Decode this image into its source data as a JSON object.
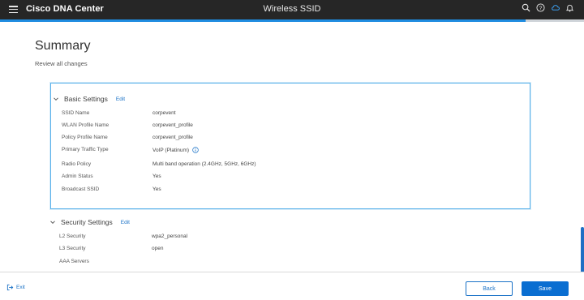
{
  "header": {
    "brand": "Cisco DNA Center",
    "title": "Wireless SSID",
    "icons": [
      "search-icon",
      "help-icon",
      "cloud-icon",
      "bell-icon"
    ],
    "progress_percent": 90
  },
  "page": {
    "title": "Summary",
    "subtitle": "Review all changes"
  },
  "basic_settings": {
    "label": "Basic Settings",
    "edit": "Edit",
    "rows": [
      {
        "label": "SSID Name",
        "value": "corpevent"
      },
      {
        "label": "WLAN Profile Name",
        "value": "corpevent_profile"
      },
      {
        "label": "Policy Profile Name",
        "value": "corpevent_profile"
      },
      {
        "label": "Primary Traffic Type",
        "value": "VoIP (Platinum)"
      },
      {
        "label": "Radio Policy",
        "value": "Multi band operation (2.4GHz, 5GHz, 6GHz)"
      },
      {
        "label": "Admin Status",
        "value": "Yes"
      },
      {
        "label": "Broadcast SSID",
        "value": "Yes"
      }
    ]
  },
  "security_settings": {
    "label": "Security Settings",
    "edit": "Edit",
    "rows": [
      {
        "label": "L2 Security",
        "value": "wpa2_personal"
      },
      {
        "label": "L3 Security",
        "value": "open"
      },
      {
        "label": "AAA Servers",
        "value": ""
      }
    ]
  },
  "footer": {
    "exit": "Exit",
    "back": "Back",
    "save": "Save"
  },
  "colors": {
    "accent": "#1a72c7",
    "primary_button": "#0a6ed1",
    "topbar": "#262626",
    "focus_border": "#58b1ea"
  }
}
